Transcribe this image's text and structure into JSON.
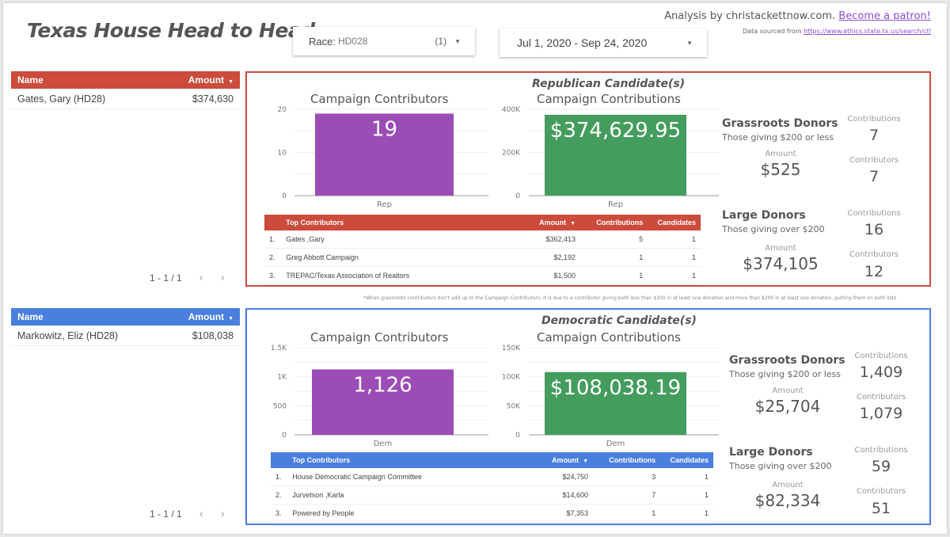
{
  "header": {
    "title": "Texas House Head to Head",
    "race_filter": {
      "label": "Race:",
      "value": "HD028",
      "count": "(1)"
    },
    "date_range": "Jul 1, 2020 - Sep 24, 2020",
    "credit_text": "Analysis by christackettnow.com.",
    "patron_link": "Become a patron!",
    "source_text": "Data sourced from",
    "source_link": "https://www.ethics.state.tx.us/search/cf/"
  },
  "colors": {
    "rep": "#cc4b3b",
    "dem": "#4a7fde",
    "contributors_bar": "#9c4db5",
    "contributions_bar": "#449d5d"
  },
  "republican": {
    "candidates_table": {
      "headers": {
        "name": "Name",
        "amount": "Amount"
      },
      "rows": [
        {
          "name": "Gates, Gary (HD28)",
          "amount": "$374,630"
        }
      ],
      "pager": "1 - 1 / 1"
    },
    "panel_title": "Republican Candidate(s)",
    "top_contributors": {
      "headers": {
        "name": "Top Contributors",
        "amount": "Amount",
        "contributions": "Contributions",
        "candidates": "Candidates"
      },
      "rows": [
        {
          "idx": "1.",
          "name": "Gates ,Gary",
          "amount": "$362,413",
          "contributions": "5",
          "candidates": "1"
        },
        {
          "idx": "2.",
          "name": "Greg Abbott Campaign",
          "amount": "$2,192",
          "contributions": "1",
          "candidates": "1"
        },
        {
          "idx": "3.",
          "name": "TREPAC/Texas Association of Realtors",
          "amount": "$1,500",
          "contributions": "1",
          "candidates": "1"
        }
      ]
    },
    "grassroots": {
      "title": "Grassroots Donors",
      "subtitle": "Those giving $200 or less",
      "amount_label": "Amount",
      "amount": "$525",
      "contributions_label": "Contributions",
      "contributions": "7",
      "contributors_label": "Contributors",
      "contributors": "7"
    },
    "large": {
      "title": "Large Donors",
      "subtitle": "Those giving over $200",
      "amount_label": "Amount",
      "amount": "$374,105",
      "contributions_label": "Contributions",
      "contributions": "16",
      "contributors_label": "Contributors",
      "contributors": "12"
    }
  },
  "democratic": {
    "candidates_table": {
      "headers": {
        "name": "Name",
        "amount": "Amount"
      },
      "rows": [
        {
          "name": "Markowitz, Eliz (HD28)",
          "amount": "$108,038"
        }
      ],
      "pager": "1 - 1 / 1"
    },
    "panel_title": "Democratic Candidate(s)",
    "top_contributors": {
      "headers": {
        "name": "Top Contributors",
        "amount": "Amount",
        "contributions": "Contributions",
        "candidates": "Candidates"
      },
      "rows": [
        {
          "idx": "1.",
          "name": "House Democratic Campaign Committee",
          "amount": "$24,750",
          "contributions": "3",
          "candidates": "1"
        },
        {
          "idx": "2.",
          "name": "Jurvetson ,Karla",
          "amount": "$14,600",
          "contributions": "7",
          "candidates": "1"
        },
        {
          "idx": "3.",
          "name": "Powered by People",
          "amount": "$7,353",
          "contributions": "1",
          "candidates": "1"
        }
      ]
    },
    "grassroots": {
      "title": "Grassroots Donors",
      "subtitle": "Those giving $200 or less",
      "amount_label": "Amount",
      "amount": "$25,704",
      "contributions_label": "Contributions",
      "contributions": "1,409",
      "contributors_label": "Contributors",
      "contributors": "1,079"
    },
    "large": {
      "title": "Large Donors",
      "subtitle": "Those giving over $200",
      "amount_label": "Amount",
      "amount": "$82,334",
      "contributions_label": "Contributions",
      "contributions": "59",
      "contributors_label": "Contributors",
      "contributors": "51"
    }
  },
  "footnote": "*When grassroots contributors don't add up to the Campaign Contributors, it is due to a contributor giving both less than $200 in at least one donation and more than $200 in at least one donation, putting them on both lists",
  "chart_data": [
    {
      "id": "rep_contributors",
      "type": "bar",
      "title": "Campaign Contributors",
      "categories": [
        "Rep"
      ],
      "values": [
        19
      ],
      "data_label": "19",
      "ylim": [
        0,
        20
      ],
      "yticks": [
        0,
        10,
        20
      ],
      "ytick_labels": [
        "0",
        "10",
        "20"
      ],
      "grid": true,
      "color": "#9c4db5"
    },
    {
      "id": "rep_contributions",
      "type": "bar",
      "title": "Campaign Contributions",
      "categories": [
        "Rep"
      ],
      "values": [
        374629.95
      ],
      "data_label": "$374,629.95",
      "ylim": [
        0,
        400000
      ],
      "yticks": [
        0,
        200000,
        400000
      ],
      "ytick_labels": [
        "0",
        "200K",
        "400K"
      ],
      "grid": true,
      "color": "#449d5d"
    },
    {
      "id": "dem_contributors",
      "type": "bar",
      "title": "Campaign Contributors",
      "categories": [
        "Dem"
      ],
      "values": [
        1126
      ],
      "data_label": "1,126",
      "ylim": [
        0,
        1500
      ],
      "yticks": [
        0,
        500,
        1000,
        1500
      ],
      "ytick_labels": [
        "0",
        "500",
        "1K",
        "1.5K"
      ],
      "grid": true,
      "color": "#9c4db5"
    },
    {
      "id": "dem_contributions",
      "type": "bar",
      "title": "Campaign Contributions",
      "categories": [
        "Dem"
      ],
      "values": [
        108038.19
      ],
      "data_label": "$108,038.19",
      "ylim": [
        0,
        150000
      ],
      "yticks": [
        0,
        50000,
        100000,
        150000
      ],
      "ytick_labels": [
        "0",
        "50K",
        "100K",
        "150K"
      ],
      "grid": true,
      "color": "#449d5d"
    }
  ]
}
